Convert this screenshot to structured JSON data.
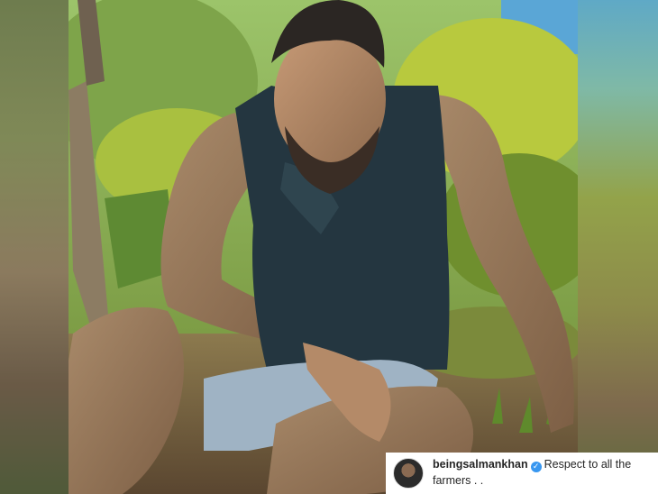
{
  "post": {
    "username": "beingsalmankhan",
    "caption": "Respect to all the farmers . .",
    "verified": true
  },
  "icons": {
    "verified": "verified-badge-icon",
    "avatar": "profile-avatar"
  },
  "colors": {
    "verified_blue": "#3897f0",
    "caption_text": "#262626",
    "caption_bg": "#ffffff"
  }
}
